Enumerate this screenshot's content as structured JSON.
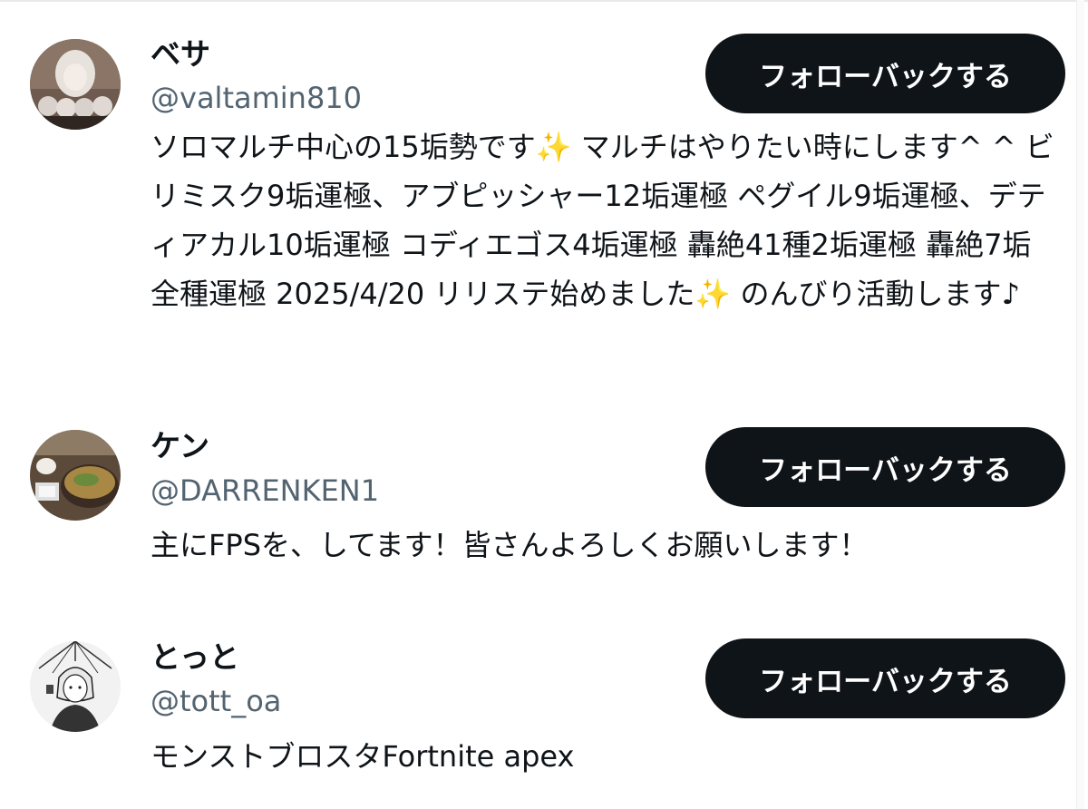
{
  "users": [
    {
      "display_name": "ベサ",
      "handle": "@valtamin810",
      "follow_label": "フォローバックする",
      "bio": "ソロマルチ中心の15垢勢です✨ マルチはやりたい時にします^ ^ ビリミスク9垢運極、アブピッシャー12垢運極 ペグイル9垢運極、デティアカル10垢運極 コディエゴス4垢運極 轟絶41種2垢運極 轟絶7垢全種運極 2025/4/20 リリステ始めました✨ のんびり活動します♪"
    },
    {
      "display_name": "ケン",
      "handle": "@DARRENKEN1",
      "follow_label": "フォローバックする",
      "bio": "主にFPSを、してます！皆さんよろしくお願いします！"
    },
    {
      "display_name": "とっと",
      "handle": "@tott_oa",
      "follow_label": "フォローバックする",
      "bio": "モンストブロスタFortnite apex"
    }
  ]
}
